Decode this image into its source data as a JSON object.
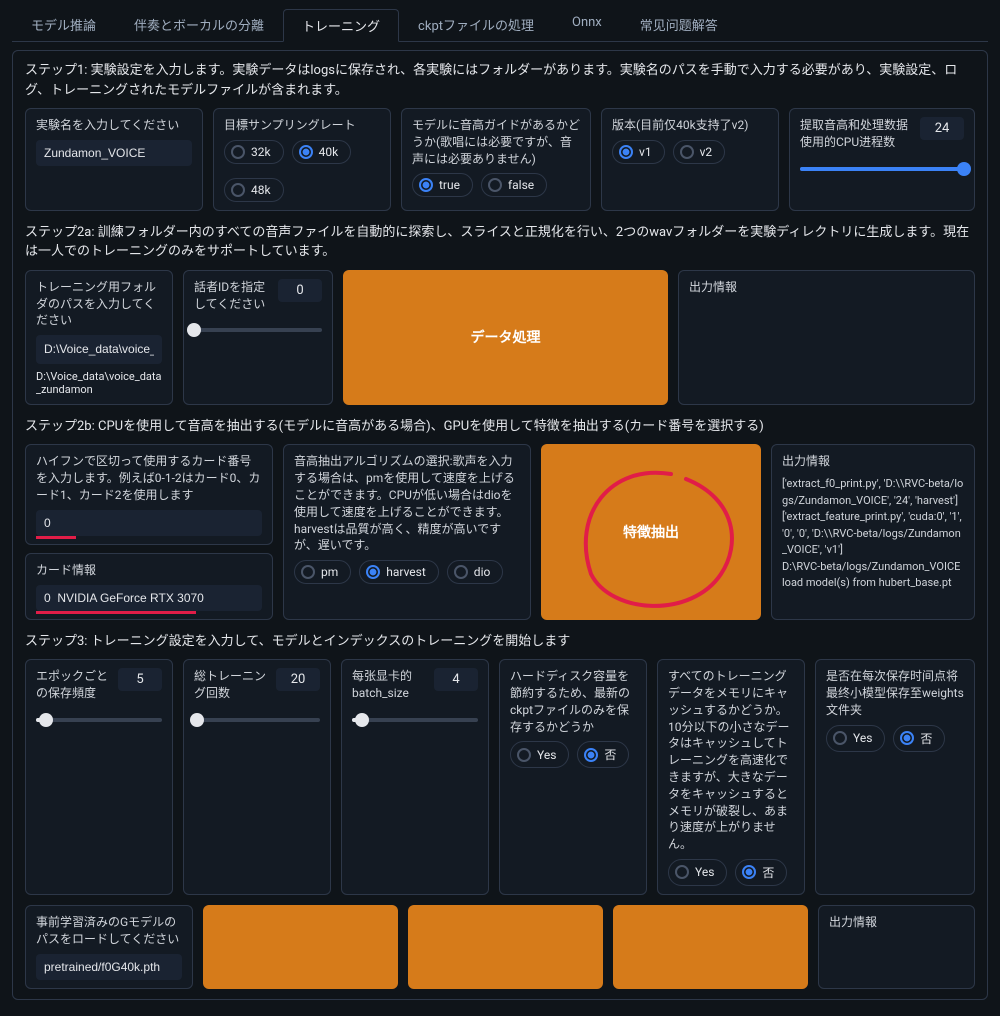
{
  "tabs": {
    "t0": "モデル推論",
    "t1": "伴奏とボーカルの分離",
    "t2": "トレーニング",
    "t3": "ckptファイルの処理",
    "t4": "Onnx",
    "t5": "常见问题解答"
  },
  "step1": {
    "text": "ステップ1: 実験設定を入力します。実験データはlogsに保存され、各実験にはフォルダーがあります。実験名のパスを手動で入力する必要があり、実験設定、ログ、トレーニングされたモデルファイルが含まれます。",
    "exp_name_label": "実験名を入力してください",
    "exp_name_value": "Zundamon_VOICE",
    "sr_label": "目標サンプリングレート",
    "sr_32k": "32k",
    "sr_40k": "40k",
    "sr_48k": "48k",
    "f0_label": "モデルに音高ガイドがあるかどうか(歌唱には必要ですが、音声には必要ありません)",
    "f0_true": "true",
    "f0_false": "false",
    "ver_label": "版本(目前仅40k支持了v2)",
    "ver_v1": "v1",
    "ver_v2": "v2",
    "cpu_label": "提取音高和处理数据使用的CPU进程数",
    "cpu_value": "24"
  },
  "step2a": {
    "text": "ステップ2a: 訓練フォルダー内のすべての音声ファイルを自動的に探索し、スライスと正規化を行い、2つのwavフォルダーを実験ディレクトリに生成します。現在は一人でのトレーニングのみをサポートしています。",
    "path_label": "トレーニング用フォルダのパスを入力してください",
    "path_value": "D:\\Voice_data\\voice_data_zundamon",
    "spk_label": "話者IDを指定してください",
    "spk_value": "0",
    "btn": "データ処理",
    "out_label": "出力情報"
  },
  "step2b": {
    "text": "ステップ2b: CPUを使用して音高を抽出する(モデルに音高がある場合)、GPUを使用して特徴を抽出する(カード番号を選択する)",
    "cards_label": "ハイフンで区切って使用するカード番号を入力します。例えば0-1-2はカード0、カード1、カード2を使用します",
    "cards_value": "0",
    "gpu_label": "カード情報",
    "gpu_value": "0  NVIDIA GeForce RTX 3070",
    "algo_label": "音高抽出アルゴリズムの選択:歌声を入力する場合は、pmを使用して速度を上げることができます。CPUが低い場合はdioを使用して速度を上げることができます。harvestは品質が高く、精度が高いですが、遅いです。",
    "algo_pm": "pm",
    "algo_harvest": "harvest",
    "algo_dio": "dio",
    "btn": "特徴抽出",
    "out_label": "出力情報",
    "out_text": "['extract_f0_print.py', 'D:\\\\RVC-beta/logs/Zundamon_VOICE', '24', 'harvest']\n['extract_feature_print.py', 'cuda:0', '1', '0', '0', 'D:\\\\RVC-beta/logs/Zundamon_VOICE', 'v1']\nD:\\RVC-beta/logs/Zundamon_VOICE\nload model(s) from hubert_base.pt"
  },
  "step3": {
    "text": "ステップ3: トレーニング設定を入力して、モデルとインデックスのトレーニングを開始します",
    "save_freq_label": "エポックごとの保存頻度",
    "save_freq_value": "5",
    "epoch_label": "総トレーニング回数",
    "epoch_value": "20",
    "batch_label": "每张显卡的batch_size",
    "batch_value": "4",
    "latest_label": "ハードディスク容量を節約するため、最新のckptファイルのみを保存するかどうか",
    "cache_label": "すべてのトレーニングデータをメモリにキャッシュするかどうか。10分以下の小さなデータはキャッシュしてトレーニングを高速化できますが、大きなデータをキャッシュするとメモリが破裂し、あまり速度が上がりません。",
    "weights_label": "是否在每次保存时间点将最终小模型保存至weights文件夹",
    "yes": "Yes",
    "no": "否",
    "g_label": "事前学習済みのGモデルのパスをロードしてください",
    "g_value": "pretrained/f0G40k.pth",
    "out_label": "出力情報"
  }
}
